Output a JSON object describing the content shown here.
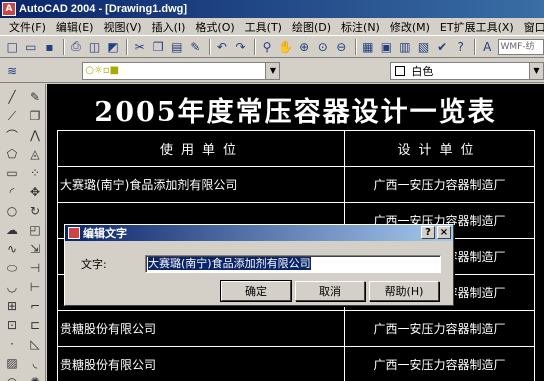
{
  "window": {
    "title": "AutoCAD 2004 - [Drawing1.dwg]",
    "app_icon": "A"
  },
  "menu": [
    "文件(F)",
    "编辑(E)",
    "视图(V)",
    "插入(I)",
    "格式(O)",
    "工具(T)",
    "绘图(D)",
    "标注(N)",
    "修改(M)",
    "ET扩展工具(X)",
    "窗口(W)"
  ],
  "toolbar": {
    "combo_text": "WMF-纺"
  },
  "properties": {
    "color_label": "白色"
  },
  "drawing": {
    "title": "2005年度常压容器设计一览表",
    "header": {
      "col1": "使用单位",
      "col2": "设计单位"
    },
    "rows": [
      {
        "col1": "大赛璐(南宁)食品添加剂有限公司",
        "col2": "广西一安压力容器制造厂"
      },
      {
        "col1": "",
        "col2": "广西一安压力容器制造厂"
      },
      {
        "col1": "",
        "col2": "广西一安压力容器制造厂"
      },
      {
        "col1": "",
        "col2": "广西一安压力容器制造厂"
      },
      {
        "col1": "贵糖股份有限公司",
        "col2": "广西一安压力容器制造厂"
      },
      {
        "col1": "贵糖股份有限公司",
        "col2": "广西一安压力容器制造厂"
      }
    ]
  },
  "dialog": {
    "title": "编辑文字",
    "help_glyph": "?",
    "close_glyph": "×",
    "field_label": "文字:",
    "field_value": "大赛璐(南宁)食品添加剂有限公司",
    "ok": "确定",
    "cancel": "取消",
    "help": "帮助(H)"
  }
}
